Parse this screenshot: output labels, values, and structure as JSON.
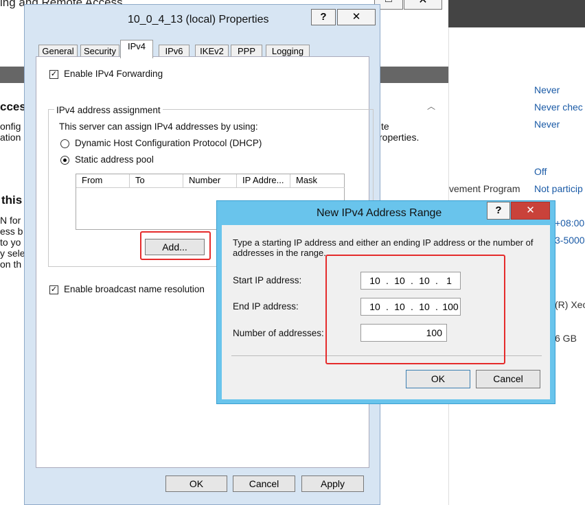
{
  "background": {
    "title_fragment": "ing and Remote Access",
    "left_fragments": [
      "cces",
      "onfig",
      "ation",
      "this",
      "N for",
      "ess b",
      "to yo",
      "y sele",
      "on th"
    ],
    "middle_fragments": [
      "te",
      "roperties."
    ],
    "right_values": [
      "Never",
      "Never chec",
      "Never",
      "Off",
      "Not particip",
      "+08:00",
      "3-5000",
      "(R) Xeo",
      "6 GB"
    ],
    "right_label": "vement Program",
    "window_buttons": [
      "□",
      "✕"
    ]
  },
  "properties_dialog": {
    "title": "10_0_4_13 (local) Properties",
    "help_label": "?",
    "close_label": "✕",
    "tabs": [
      "General",
      "Security",
      "IPv4",
      "IPv6",
      "IKEv2",
      "PPP",
      "Logging"
    ],
    "active_tab": "IPv4",
    "enable_forwarding": {
      "label": "Enable IPv4 Forwarding",
      "checked": true
    },
    "assignment_group": {
      "title": "IPv4 address assignment",
      "description": "This server can assign IPv4 addresses by using:",
      "options": [
        {
          "label": "Dynamic Host Configuration Protocol (DHCP)",
          "selected": false
        },
        {
          "label": "Static address pool",
          "selected": true
        }
      ],
      "columns": [
        "From",
        "To",
        "Number",
        "IP Addre...",
        "Mask"
      ],
      "rows": [],
      "add_label": "Add..."
    },
    "broadcast": {
      "label": "Enable broadcast name resolution",
      "checked": true
    },
    "buttons": {
      "ok": "OK",
      "cancel": "Cancel",
      "apply": "Apply"
    }
  },
  "range_dialog": {
    "title": "New IPv4 Address Range",
    "help_label": "?",
    "close_label": "✕",
    "instructions": "Type a starting IP address and either an ending IP address or the number of addresses in the range.",
    "start_label": "Start IP address:",
    "start_ip": [
      "10",
      "10",
      "10",
      "1"
    ],
    "end_label": "End IP address:",
    "end_ip": [
      "10",
      "10",
      "10",
      "100"
    ],
    "count_label": "Number of addresses:",
    "count_value": "100",
    "ok_label": "OK",
    "cancel_label": "Cancel"
  },
  "colors": {
    "dialog_frame": "#d7e5f3",
    "range_frame": "#69c4ec",
    "highlight": "#e52a2a",
    "close_red": "#c9423a"
  }
}
